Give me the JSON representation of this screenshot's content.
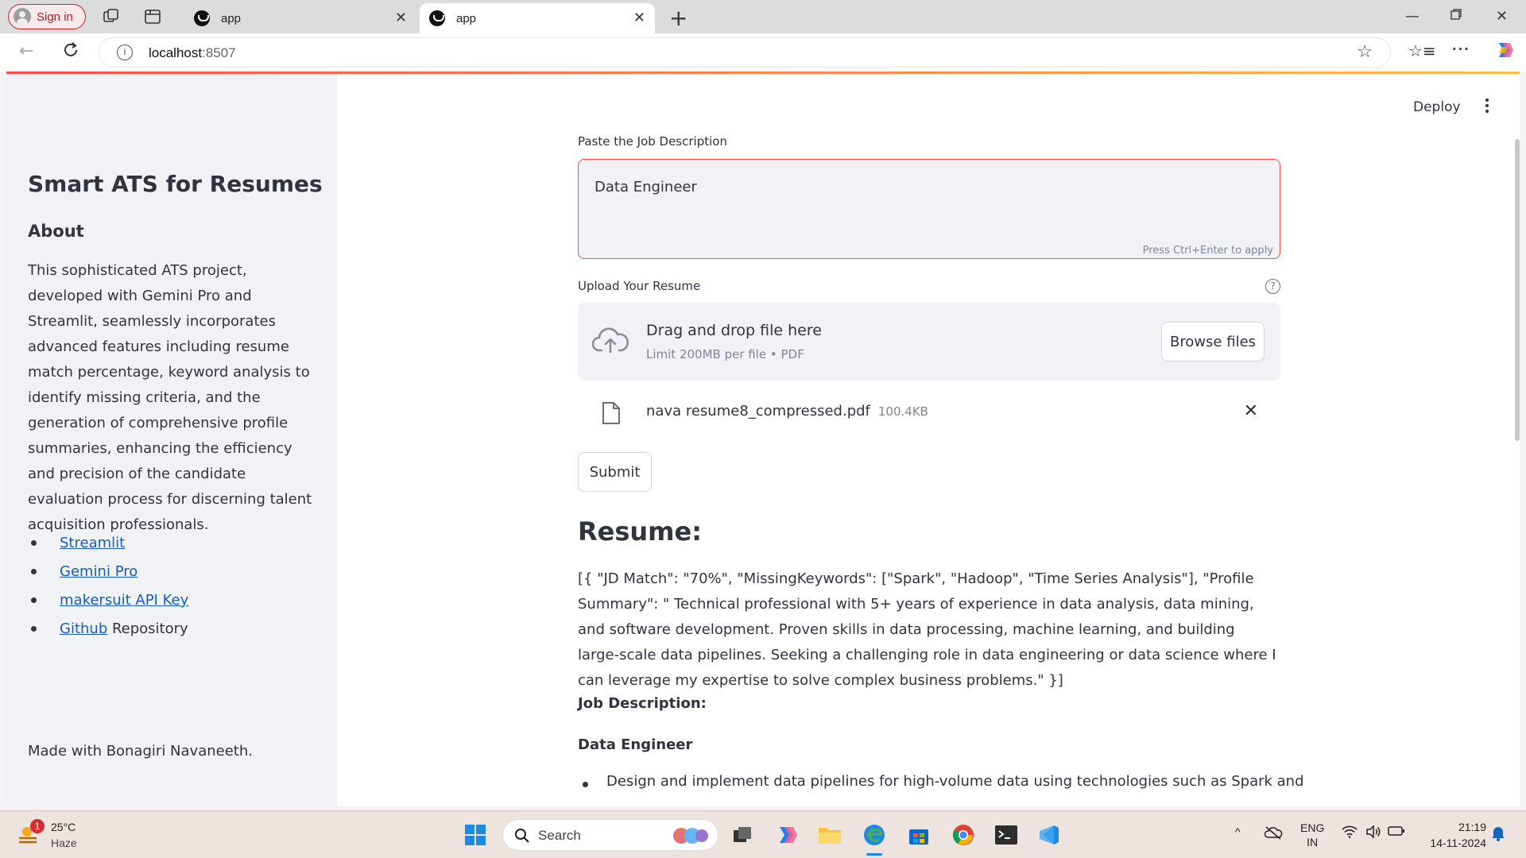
{
  "browser": {
    "signin_label": "Sign in",
    "tabs": [
      {
        "title": "app",
        "active": false
      },
      {
        "title": "app",
        "active": true
      }
    ],
    "url_host": "localhost",
    "url_port": ":8507"
  },
  "sidebar": {
    "title": "Smart ATS for Resumes",
    "about_heading": "About",
    "description": "This sophisticated ATS project, developed with Gemini Pro and Streamlit, seamlessly incorporates advanced features including resume match percentage, keyword analysis to identify missing criteria, and the generation of comprehensive profile summaries, enhancing the efficiency and precision of the candidate evaluation process for discerning talent acquisition professionals.",
    "links": [
      {
        "label": "Streamlit",
        "suffix": ""
      },
      {
        "label": "Gemini Pro",
        "suffix": ""
      },
      {
        "label": "makersuit API Key",
        "suffix": ""
      },
      {
        "label": "Github",
        "suffix": " Repository"
      }
    ],
    "footer": "Made with Bonagiri Navaneeth."
  },
  "header": {
    "deploy_label": "Deploy"
  },
  "main": {
    "jd_label": "Paste the Job Description",
    "jd_value": "Data Engineer",
    "jd_hint": "Press Ctrl+Enter to apply",
    "upload_label": "Upload Your Resume",
    "help_symbol": "?",
    "dropzone_title": "Drag and drop file here",
    "dropzone_sub": "Limit 200MB per file • PDF",
    "browse_label": "Browse files",
    "file_name": "nava resume8_compressed.pdf",
    "file_size": "100.4KB",
    "submit_label": "Submit",
    "resume_heading": "Resume:",
    "resume_output": "[{ \"JD Match\": \"70%\", \"MissingKeywords\": [\"Spark\", \"Hadoop\", \"Time Series Analysis\"], \"Profile Summary\": \" Technical professional with 5+ years of experience in data analysis, data mining, and software development. Proven skills in data processing, machine learning, and building large-scale data pipelines. Seeking a challenging role in data engineering or data science where I can leverage my expertise to solve complex business problems.\" }]",
    "jd_heading": "Job Description:",
    "jd_title": "Data Engineer",
    "jd_bullet_1": "Design and implement data pipelines for high-volume data using technologies such as Spark and"
  },
  "taskbar": {
    "weather_temp": "25°C",
    "weather_cond": "Haze",
    "weather_badge": "1",
    "search_placeholder": "Search",
    "lang_1": "ENG",
    "lang_2": "IN",
    "time": "21:19",
    "date": "14-11-2024"
  }
}
